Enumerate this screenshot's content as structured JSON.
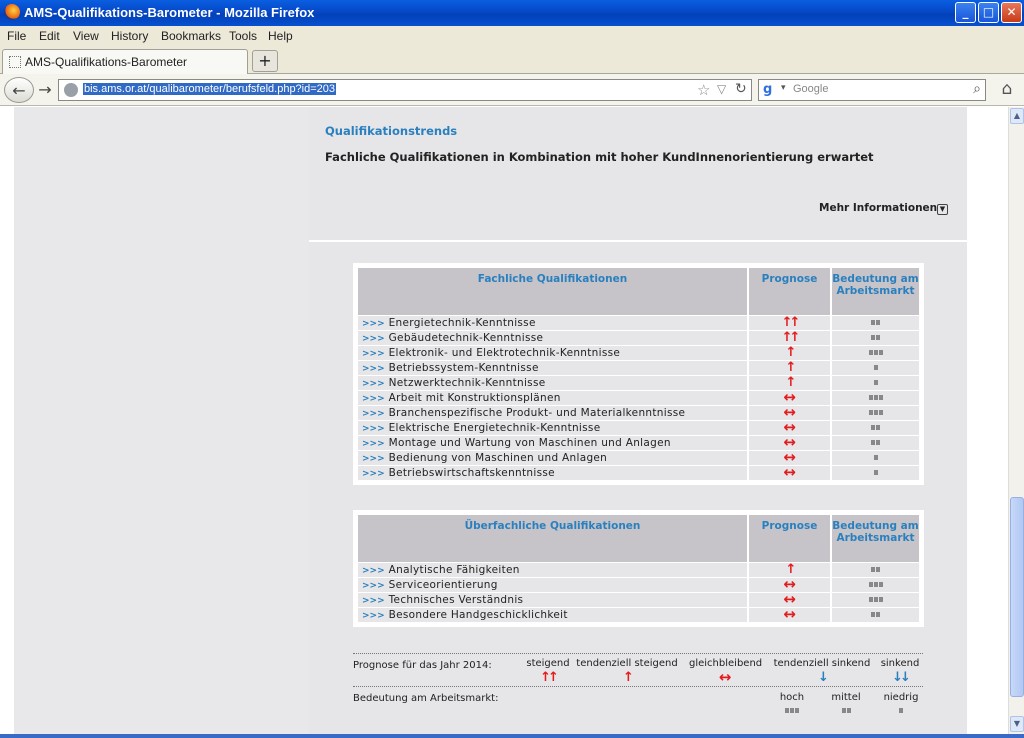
{
  "window": {
    "title": "AMS-Qualifikations-Barometer - Mozilla Firefox",
    "controls": {
      "minimize": "_",
      "maximize": "□",
      "close": "✕"
    }
  },
  "menu": [
    "File",
    "Edit",
    "View",
    "History",
    "Bookmarks",
    "Tools",
    "Help"
  ],
  "tab": {
    "label": "AMS-Qualifikations-Barometer",
    "new_tab": "+"
  },
  "nav": {
    "url": "bis.ams.or.at/qualibarometer/berufsfeld.php?id=203",
    "search_placeholder": "Google"
  },
  "trends": {
    "heading": "Qualifikationstrends",
    "text": "Fachliche Qualifikationen in Kombination mit hoher KundInnenorientierung erwartet",
    "more": "Mehr Informationen"
  },
  "glyphs": {
    "row_arrow": ">>>",
    "up_strong": "↑↑",
    "up": "↑",
    "steady": "↔",
    "down": "↓",
    "down_strong": "↓↓"
  },
  "fachlich": {
    "headers": {
      "name": "Fachliche Qualifikationen",
      "prognose": "Prognose",
      "bedeutung": "Bedeutung am Arbeitsmarkt"
    },
    "rows": [
      {
        "name": "Energietechnik-Kenntnisse",
        "prognose": "steigend",
        "bedeutung": 2
      },
      {
        "name": "Gebäudetechnik-Kenntnisse",
        "prognose": "steigend",
        "bedeutung": 2
      },
      {
        "name": "Elektronik- und Elektrotechnik-Kenntnisse",
        "prognose": "tendenziell steigend",
        "bedeutung": 3
      },
      {
        "name": "Betriebssystem-Kenntnisse",
        "prognose": "tendenziell steigend",
        "bedeutung": 1
      },
      {
        "name": "Netzwerktechnik-Kenntnisse",
        "prognose": "tendenziell steigend",
        "bedeutung": 1
      },
      {
        "name": "Arbeit mit Konstruktionsplänen",
        "prognose": "gleichbleibend",
        "bedeutung": 3
      },
      {
        "name": "Branchenspezifische Produkt- und Materialkenntnisse",
        "prognose": "gleichbleibend",
        "bedeutung": 3
      },
      {
        "name": "Elektrische Energietechnik-Kenntnisse",
        "prognose": "gleichbleibend",
        "bedeutung": 2
      },
      {
        "name": "Montage und Wartung von Maschinen und Anlagen",
        "prognose": "gleichbleibend",
        "bedeutung": 2
      },
      {
        "name": "Bedienung von Maschinen und Anlagen",
        "prognose": "gleichbleibend",
        "bedeutung": 1
      },
      {
        "name": "Betriebswirtschaftskenntnisse",
        "prognose": "gleichbleibend",
        "bedeutung": 1
      }
    ]
  },
  "ueberfachlich": {
    "headers": {
      "name": "Überfachliche Qualifikationen",
      "prognose": "Prognose",
      "bedeutung": "Bedeutung am Arbeitsmarkt"
    },
    "rows": [
      {
        "name": "Analytische Fähigkeiten",
        "prognose": "tendenziell steigend",
        "bedeutung": 2
      },
      {
        "name": "Serviceorientierung",
        "prognose": "gleichbleibend",
        "bedeutung": 3
      },
      {
        "name": "Technisches Verständnis",
        "prognose": "gleichbleibend",
        "bedeutung": 3
      },
      {
        "name": "Besondere Handgeschicklichkeit",
        "prognose": "gleichbleibend",
        "bedeutung": 2
      }
    ]
  },
  "legend": {
    "prognose_label": "Prognose für das Jahr 2014:",
    "prognose_items": [
      {
        "label": "steigend",
        "symbol": "steigend"
      },
      {
        "label": "tendenziell steigend",
        "symbol": "tendenziell steigend"
      },
      {
        "label": "gleichbleibend",
        "symbol": "gleichbleibend"
      },
      {
        "label": "tendenziell sinkend",
        "symbol": "tendenziell sinkend"
      },
      {
        "label": "sinkend",
        "symbol": "sinkend"
      }
    ],
    "bedeutung_label": "Bedeutung am Arbeitsmarkt:",
    "bedeutung_items": [
      {
        "label": "hoch",
        "level": 3
      },
      {
        "label": "mittel",
        "level": 2
      },
      {
        "label": "niedrig",
        "level": 1
      }
    ]
  },
  "colors": {
    "link_blue": "#2a80bf",
    "arrow_red": "#e41a1c",
    "panel_gray": "#e6e5e7",
    "header_gray": "#c6c4c8"
  }
}
